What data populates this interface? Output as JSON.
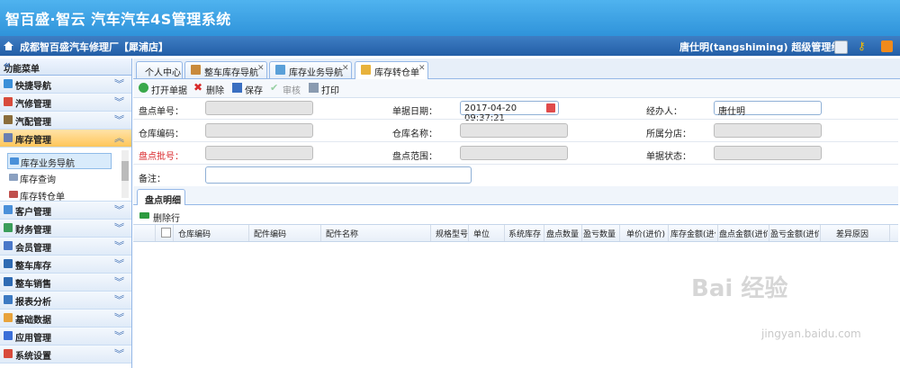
{
  "app_title": "智百盛·智云 汽车汽车4S管理系统",
  "company": "成都智百盛汽车修理厂【犀浦店】",
  "user": "唐仕明(tangshiming) 超级管理组",
  "sidebar": {
    "title": "功能菜单",
    "collapse_icon": "«",
    "items": [
      {
        "label": "快捷导航",
        "icon_color": "#3b8fd8"
      },
      {
        "label": "汽修管理",
        "icon_color": "#d84b3b"
      },
      {
        "label": "汽配管理",
        "icon_color": "#8a6d3b"
      },
      {
        "label": "库存管理",
        "icon_color": "#6b7fb0",
        "active": true
      },
      {
        "label": "客户管理",
        "icon_color": "#4a90d9"
      },
      {
        "label": "财务管理",
        "icon_color": "#3b9e5a"
      },
      {
        "label": "会员管理",
        "icon_color": "#4a78c9"
      },
      {
        "label": "整车库存",
        "icon_color": "#2f6bb3"
      },
      {
        "label": "整车销售",
        "icon_color": "#2f6bb3"
      },
      {
        "label": "报表分析",
        "icon_color": "#3d7ac2"
      },
      {
        "label": "基础数据",
        "icon_color": "#e8a33b"
      },
      {
        "label": "应用管理",
        "icon_color": "#3b6fd8"
      },
      {
        "label": "系统设置",
        "icon_color": "#d84b3b"
      }
    ],
    "sub_items": [
      "库存业务导航",
      "库存查询",
      "库存转仓单"
    ]
  },
  "tabs": [
    {
      "label": "个人中心",
      "closable": false
    },
    {
      "label": "整车库存导航",
      "closable": true
    },
    {
      "label": "库存业务导航",
      "closable": true
    },
    {
      "label": "库存转仓单",
      "closable": true,
      "active": true
    }
  ],
  "toolbar": [
    "打开单据",
    "删除",
    "保存",
    "审核",
    "打印"
  ],
  "form": {
    "order_no_label": "盘点单号：",
    "date_label": "单据日期：",
    "date_value": "2017-04-20 09:37:21",
    "handler_label": "经办人：",
    "handler_value": "唐仕明",
    "warehouse_code_label": "仓库编码：",
    "warehouse_name_label": "仓库名称：",
    "branch_label": "所属分店：",
    "batch_label": "盘点批号：",
    "range_label": "盘点范围：",
    "status_label": "单据状态：",
    "remark_label": "备注："
  },
  "panel_tab": "盘点明细",
  "delete_row": "删除行",
  "columns": [
    "仓库编码",
    "配件编码",
    "配件名称",
    "规格型号",
    "单位",
    "系统库存",
    "盘点数量",
    "盈亏数量",
    "单价(进价)",
    "库存金额(进价)",
    "盘点金额(进价)",
    "盈亏金额(进价)",
    "差异原因"
  ],
  "watermark": {
    "main": "Bai 经验",
    "sub": "jingyan.baidu.com"
  },
  "colors": {
    "header": "#3fa5e8",
    "bar": "#2f6cb5",
    "active_menu": "#ffc65a",
    "required_label": "#d9262a"
  }
}
